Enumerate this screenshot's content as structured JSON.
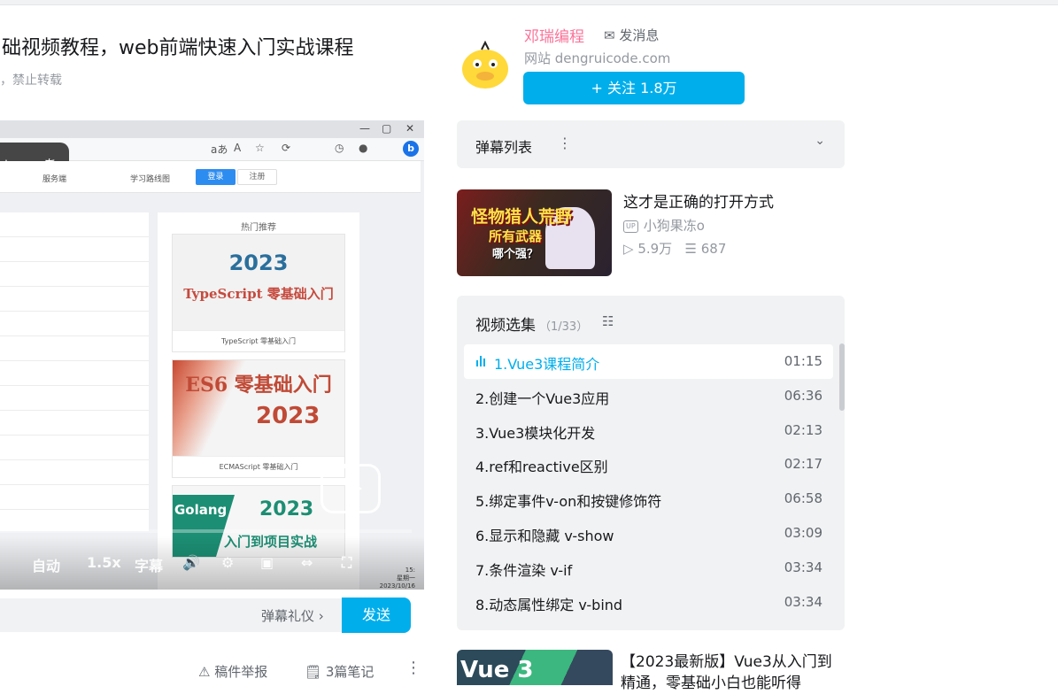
{
  "video": {
    "title": "础视频教程，web前端快速入门实战课程",
    "copyright": "，禁止转载"
  },
  "player": {
    "window_controls": [
      "—",
      "▢",
      "✕"
    ],
    "float_tools": {
      "ai_icon": "ai-magic-icon",
      "translate": "aあ"
    },
    "site_nav": {
      "item1": "服务端",
      "item2": "学习路线图",
      "login": "登录",
      "register": "注册"
    },
    "hot_title": "热门推荐",
    "cards": [
      {
        "year": "2023",
        "name": "TypeScript 零基础入门",
        "caption": "TypeScript 零基础入门"
      },
      {
        "name": "ES6 零基础入门",
        "year": "2023",
        "caption": "ECMAScript 零基础入门"
      },
      {
        "word": "Golang",
        "year": "2023",
        "sub": "入门到项目实战"
      }
    ],
    "controls": {
      "auto": "自动",
      "speed": "1.5x",
      "subtitle": "字幕"
    },
    "taskbar": {
      "time": "15:",
      "weekday": "星期一",
      "date": "2023/10/16",
      "lang": "中"
    }
  },
  "danmaku": {
    "etiquette": "弹幕礼仪 ›",
    "send": "发送"
  },
  "actions": {
    "report": "稿件举报",
    "notes": "3篇笔记"
  },
  "uploader": {
    "name": "邓瑞编程",
    "message": "发消息",
    "desc": "网站 dengruicode.com",
    "follow": "+ 关注 1.8万"
  },
  "danmaku_list": {
    "title": "弹幕列表"
  },
  "recommend": {
    "title": "这才是正确的打开方式",
    "up": "小狗果冻o",
    "up_tag": "UP",
    "plays": "5.9万",
    "danmaku": "687",
    "thumb": {
      "line1": "怪物猎人荒野",
      "line2": "所有武器",
      "line3": "哪个强？"
    }
  },
  "episodes": {
    "title": "视频选集",
    "count": "（1/33）",
    "items": [
      {
        "label": "1.Vue3课程简介",
        "time": "01:15",
        "active": true
      },
      {
        "label": "2.创建一个Vue3应用",
        "time": "06:36"
      },
      {
        "label": "3.Vue3模块化开发",
        "time": "02:13"
      },
      {
        "label": "4.ref和reactive区别",
        "time": "02:17"
      },
      {
        "label": "5.绑定事件v-on和按键修饰符",
        "time": "06:58"
      },
      {
        "label": "6.显示和隐藏 v-show",
        "time": "03:09"
      },
      {
        "label": "7.条件渲染 v-if",
        "time": "03:34"
      },
      {
        "label": "8.动态属性绑定 v-bind",
        "time": "03:34"
      }
    ]
  },
  "recommend2": {
    "thumb_word": "Vue 3",
    "title": "【2023最新版】Vue3从入门到精通，零基础小白也能听得"
  },
  "colors": {
    "accent": "#00aeec",
    "up_name": "#fb7299",
    "panel": "#f1f2f3"
  }
}
